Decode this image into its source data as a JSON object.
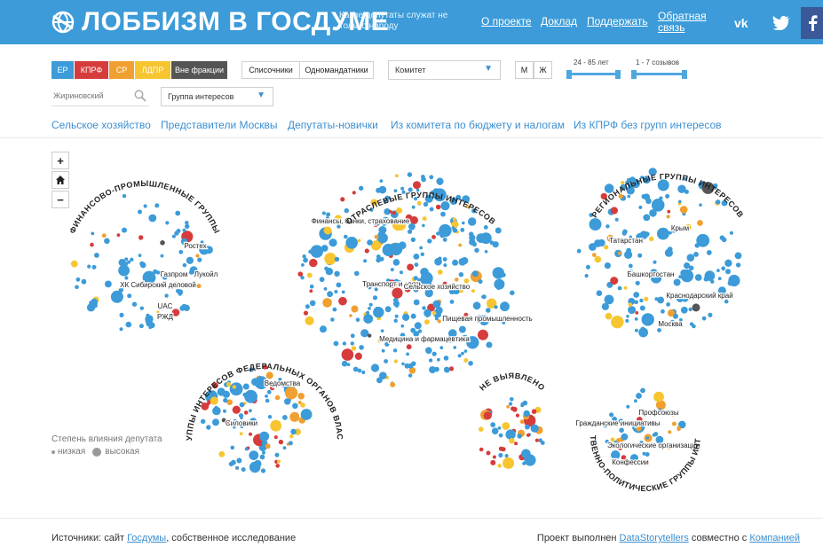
{
  "header": {
    "title": "ЛОББИЗМ В ГОСДУМЕ",
    "tagline": "Какие депутаты служат не только народу",
    "links": [
      "О проекте",
      "Доклад",
      "Поддержать",
      "Обратная связь"
    ],
    "social": [
      "vk",
      "twitter",
      "facebook"
    ]
  },
  "controls": {
    "parties": [
      {
        "label": "ЕР",
        "color": "#3c9bd8"
      },
      {
        "label": "КПРФ",
        "color": "#d63c3c"
      },
      {
        "label": "СР",
        "color": "#f0a030"
      },
      {
        "label": "ЛДПР",
        "color": "#f7c530"
      },
      {
        "label": "Вне фракции",
        "color": "#555555"
      }
    ],
    "mandate": [
      "Списочники",
      "Одномандатники"
    ],
    "committee_select": "Комитет",
    "gender": [
      "М",
      "Ж"
    ],
    "age_range": "24 - 85 лет",
    "convocation_range": "1 - 7 созывов",
    "search_placeholder": "Жириновский",
    "group_select": "Группа интересов"
  },
  "filters": [
    "Сельское хозяйство",
    "Представители Москвы",
    "Депутаты-новички",
    "Из комитета по бюджету и налогам",
    "Из КПРФ без групп интересов"
  ],
  "zoom": {
    "in": "+",
    "home": "home-icon",
    "out": "−"
  },
  "clusters": {
    "finance": {
      "title": "ФИНАНСОВО-ПРОМЫШЛЕННЫЕ ГРУППЫ",
      "labels": [
        "Ростех",
        "Газпром",
        "Лукойл",
        "ХК Сибирский деловой",
        "UAC",
        "РЖД"
      ]
    },
    "sector": {
      "title": "ОТРАСЛЕВЫЕ ГРУППЫ ИНТЕРЕСОВ",
      "labels": [
        "Финансы, банки, страхование",
        "Транспорт и связь",
        "Сельское хозяйство",
        "Пищевая промышленность",
        "Медицина и фармацевтика"
      ]
    },
    "regional": {
      "title": "РЕГИОНАЛЬНЫЕ ГРУППЫ ИНТЕРЕСОВ",
      "labels": [
        "Крым",
        "Татарстан",
        "Башкортостан",
        "Краснодарский край",
        "Москва"
      ]
    },
    "federal": {
      "title": "ГРУППЫ ИНТЕРЕСОВ ФЕДЕРАЛЬНЫХ ОРГАНОВ ВЛАСТИ",
      "labels": [
        "Ведомства",
        "Силовики"
      ]
    },
    "unknown": {
      "title": "НЕ ВЫЯВЛЕНО",
      "labels": []
    },
    "public": {
      "title": "ОБЩЕСТВЕННО-ПОЛИТИЧЕСКИЕ ГРУППЫ ИНТЕРЕСОВ",
      "labels": [
        "Профсоюзы",
        "Гражданские инициативы",
        "Экологические организации",
        "Конфессии"
      ]
    }
  },
  "legend": {
    "title": "Степень влияния депутата",
    "low": "низкая",
    "high": "высокая"
  },
  "footer": {
    "sources_prefix": "Источники: сайт ",
    "sources_link": "Госдумы",
    "sources_suffix": ", собственное исследование",
    "project_prefix": "Проект выполнен ",
    "project_link": "DataStorytellers",
    "project_middle": " совместно с ",
    "project_link2": "Компанией"
  },
  "colors": {
    "er": "#3c9bd8",
    "kprf": "#d63c3c",
    "sr": "#f0a030",
    "ldpr": "#f7c530",
    "none": "#555555"
  }
}
